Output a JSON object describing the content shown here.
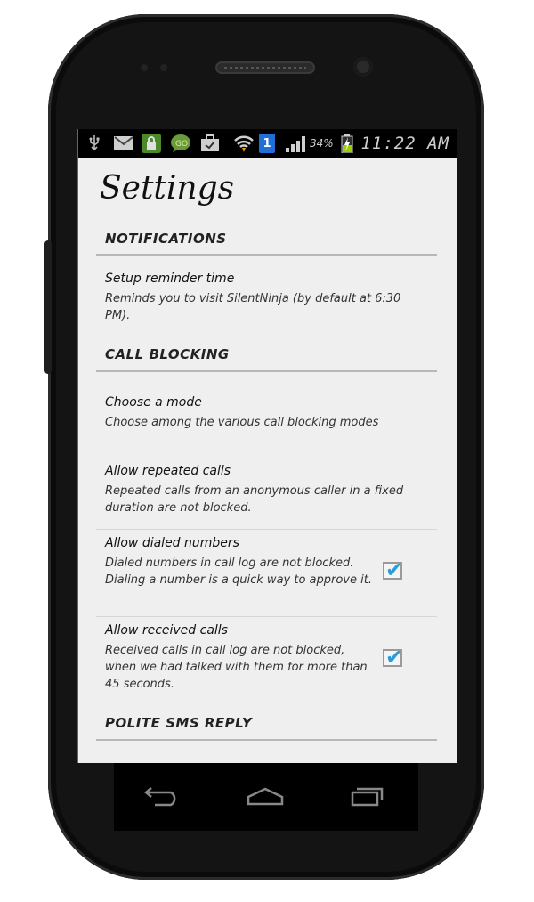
{
  "status_bar": {
    "battery_percent": "34%",
    "time": "11:22 AM",
    "sim_badge": "1",
    "icons": [
      "usb-icon",
      "gmail-icon",
      "lock-icon",
      "go-sms-icon",
      "briefcase-icon",
      "wifi-icon",
      "sim-icon",
      "signal-icon",
      "battery-icon"
    ]
  },
  "page": {
    "title": "Settings"
  },
  "categories": {
    "notifications": "NOTIFICATIONS",
    "call_blocking": "CALL BLOCKING",
    "polite_sms": "POLITE SMS REPLY"
  },
  "prefs": {
    "reminder": {
      "title": "Setup reminder time",
      "summary": "Reminds you to visit SilentNinja (by default at 6:30 PM)."
    },
    "mode": {
      "title": "Choose a mode",
      "summary": "Choose among the various call blocking modes"
    },
    "repeated": {
      "title": "Allow repeated calls",
      "summary": "Repeated calls from an anonymous caller in a fixed duration are not blocked."
    },
    "dialed": {
      "title": "Allow dialed numbers",
      "summary": "Dialed numbers in call log are not blocked. Dialing a number is a quick way to approve it.",
      "checked": true
    },
    "received": {
      "title": "Allow received calls",
      "summary": "Received calls in call log are not blocked, when we had talked with them for more than 45 seconds.",
      "checked": true
    }
  },
  "nav": {
    "back": "back-icon",
    "home": "home-icon",
    "recents": "recent-apps-icon"
  },
  "colors": {
    "accent": "#2a9cd8",
    "background": "#efefef"
  }
}
